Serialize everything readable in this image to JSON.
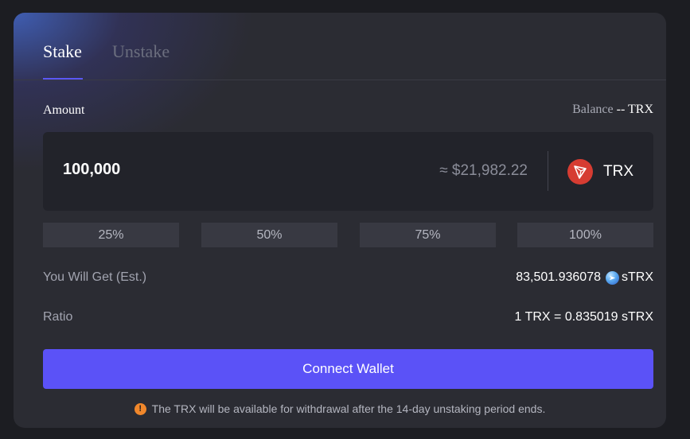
{
  "tabs": [
    {
      "label": "Stake",
      "active": true
    },
    {
      "label": "Unstake",
      "active": false
    }
  ],
  "amount": {
    "label": "Amount",
    "balance_label": "Balance",
    "balance_value": "-- TRX",
    "input_value": "100,000",
    "usd_estimate": "≈ $21,982.22",
    "token": "TRX",
    "token_icon": "tron-icon"
  },
  "percent_buttons": [
    "25%",
    "50%",
    "75%",
    "100%"
  ],
  "you_will_get": {
    "label": "You Will Get (Est.)",
    "value": "83,501.936078",
    "token": "sTRX",
    "token_icon": "strx-icon"
  },
  "ratio": {
    "label": "Ratio",
    "value": "1 TRX = 0.835019 sTRX"
  },
  "connect_button": "Connect Wallet",
  "notice": {
    "icon": "warning-icon",
    "text": "The TRX will be available for withdrawal after the 14-day unstaking period ends."
  },
  "colors": {
    "accent": "#5b52f7",
    "card_bg": "#2b2c33",
    "input_bg": "#22232a",
    "tron_red": "#d63c32",
    "warning": "#f0872b"
  }
}
